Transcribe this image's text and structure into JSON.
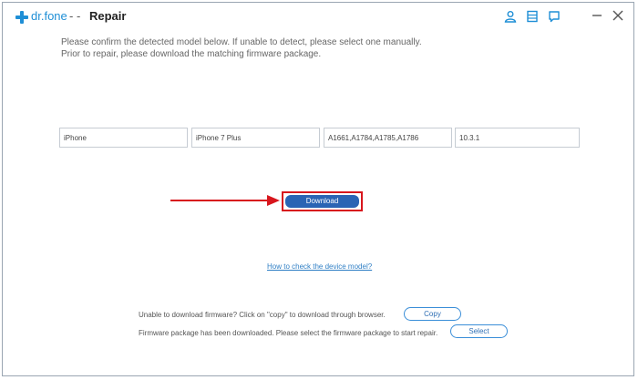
{
  "window": {
    "app_name": "dr.fone",
    "separator": "- -",
    "title": "Repair",
    "icons": [
      "account-icon",
      "document-icon",
      "feedback-icon",
      "minimize-icon",
      "close-icon"
    ],
    "brand_color": "#1f8fd6"
  },
  "instructions": {
    "line1": "Please confirm the detected model below. If unable to detect, please select one manually.",
    "line2": "Prior to repair, please download the matching firmware package."
  },
  "device_fields": [
    {
      "value": "iPhone"
    },
    {
      "value": "iPhone 7 Plus"
    },
    {
      "value": "A1661,A1784,A1785,A1786"
    },
    {
      "value": "10.3.1"
    }
  ],
  "download_button": {
    "label": "Download",
    "color": "#2a64b4",
    "highlight_color": "#d8161d"
  },
  "help_link": {
    "label": "How to check the device model?"
  },
  "copy_row": {
    "text": "Unable to download firmware? Click on \"copy\" to download through browser.",
    "button": "Copy"
  },
  "select_row": {
    "text": "Firmware package has been downloaded. Please select the firmware package to start repair.",
    "button": "Select"
  }
}
